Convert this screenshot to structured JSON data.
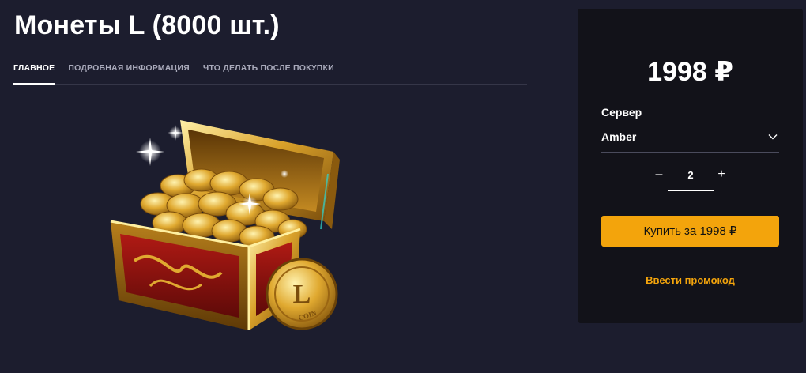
{
  "product": {
    "title": "Монеты L (8000 шт.)"
  },
  "tabs": [
    {
      "label": "ГЛАВНОЕ",
      "active": true
    },
    {
      "label": "ПОДРОБНАЯ ИНФОРМАЦИЯ",
      "active": false
    },
    {
      "label": "ЧТО ДЕЛАТЬ ПОСЛЕ ПОКУПКИ",
      "active": false
    }
  ],
  "image": {
    "coin_text": "COIN",
    "coin_letter": "L"
  },
  "purchase": {
    "price": "1998 ₽",
    "server_label": "Сервер",
    "server_value": "Amber",
    "quantity": "2",
    "minus": "–",
    "plus": "+",
    "buy_label": "Купить за 1998 ₽",
    "promo_label": "Ввести промокод"
  },
  "colors": {
    "background": "#1c1d2e",
    "panel": "#121219",
    "accent": "#f3a40c"
  }
}
